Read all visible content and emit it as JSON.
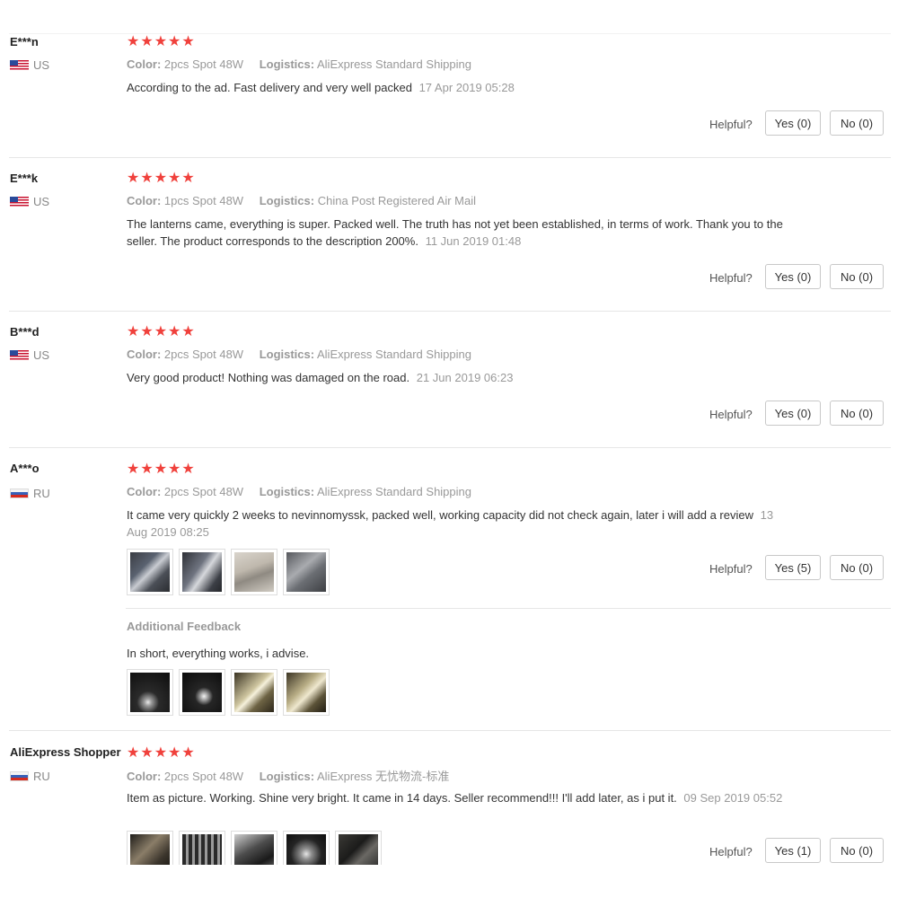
{
  "labels": {
    "color": "Color:",
    "logistics": "Logistics:",
    "helpful": "Helpful?",
    "additional_feedback": "Additional Feedback"
  },
  "star_color": "#f0413c",
  "reviews": [
    {
      "user": "E***n",
      "country": "US",
      "stars": "★★★★★",
      "color": "2pcs Spot 48W",
      "logistics": "AliExpress Standard Shipping",
      "text": "According to the ad. Fast delivery and very well packed",
      "date": "17 Apr 2019 05:28",
      "yes": "Yes (0)",
      "no": "No (0)"
    },
    {
      "user": "E***k",
      "country": "US",
      "stars": "★★★★★",
      "color": "1pcs Spot 48W",
      "logistics": "China Post Registered Air Mail",
      "text": "The lanterns came, everything is super. Packed well. The truth has not yet been established, in terms of work. Thank you to the seller. The product corresponds to the description 200%.",
      "date": "11 Jun 2019 01:48",
      "yes": "Yes (0)",
      "no": "No (0)"
    },
    {
      "user": "B***d",
      "country": "US",
      "stars": "★★★★★",
      "color": "2pcs Spot 48W",
      "logistics": "AliExpress Standard Shipping",
      "text": "Very good product! Nothing was damaged on the road.",
      "date": "21 Jun 2019 06:23",
      "yes": "Yes (0)",
      "no": "No (0)"
    },
    {
      "user": "A***o",
      "country": "RU",
      "stars": "★★★★★",
      "color": "2pcs Spot 48W",
      "logistics": "AliExpress Standard Shipping",
      "text": "It came very quickly 2 weeks to nevinnomyssk, packed well, working capacity did not check again, later i will add a review",
      "date": "13 Aug 2019 08:25",
      "yes": "Yes (5)",
      "no": "No (0)",
      "additional_text": "In short, everything works, i advise."
    },
    {
      "user": "AliExpress Shopper",
      "country": "RU",
      "stars": "★★★★★",
      "color": "2pcs Spot 48W",
      "logistics": "AliExpress 无忧物流-标准",
      "text": "Item as picture. Working. Shine very bright. It came in 14 days. Seller recommend!!! I'll add later, as i put it.",
      "date": "09 Sep 2019 05:52",
      "yes": "Yes (1)",
      "no": "No (0)"
    }
  ]
}
